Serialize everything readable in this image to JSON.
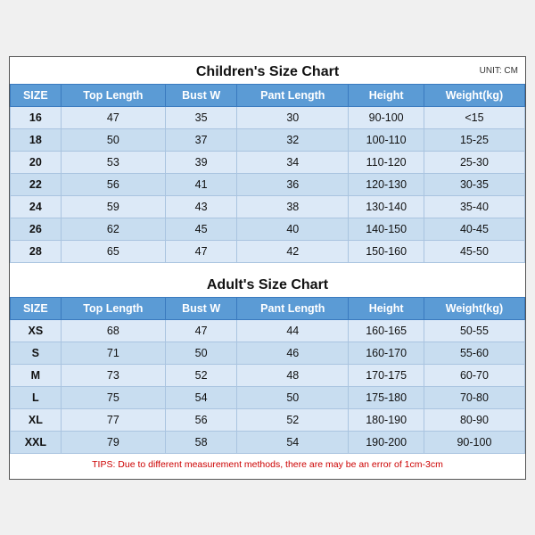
{
  "children_title": "Children's Size Chart",
  "adult_title": "Adult's Size Chart",
  "unit": "UNIT: CM",
  "tips": "TIPS: Due to different measurement methods, there are may be an error of 1cm-3cm",
  "headers": [
    "SIZE",
    "Top Length",
    "Bust W",
    "Pant Length",
    "Height",
    "Weight(kg)"
  ],
  "children_rows": [
    [
      "16",
      "47",
      "35",
      "30",
      "90-100",
      "<15"
    ],
    [
      "18",
      "50",
      "37",
      "32",
      "100-110",
      "15-25"
    ],
    [
      "20",
      "53",
      "39",
      "34",
      "110-120",
      "25-30"
    ],
    [
      "22",
      "56",
      "41",
      "36",
      "120-130",
      "30-35"
    ],
    [
      "24",
      "59",
      "43",
      "38",
      "130-140",
      "35-40"
    ],
    [
      "26",
      "62",
      "45",
      "40",
      "140-150",
      "40-45"
    ],
    [
      "28",
      "65",
      "47",
      "42",
      "150-160",
      "45-50"
    ]
  ],
  "adult_rows": [
    [
      "XS",
      "68",
      "47",
      "44",
      "160-165",
      "50-55"
    ],
    [
      "S",
      "71",
      "50",
      "46",
      "160-170",
      "55-60"
    ],
    [
      "M",
      "73",
      "52",
      "48",
      "170-175",
      "60-70"
    ],
    [
      "L",
      "75",
      "54",
      "50",
      "175-180",
      "70-80"
    ],
    [
      "XL",
      "77",
      "56",
      "52",
      "180-190",
      "80-90"
    ],
    [
      "XXL",
      "79",
      "58",
      "54",
      "190-200",
      "90-100"
    ]
  ]
}
